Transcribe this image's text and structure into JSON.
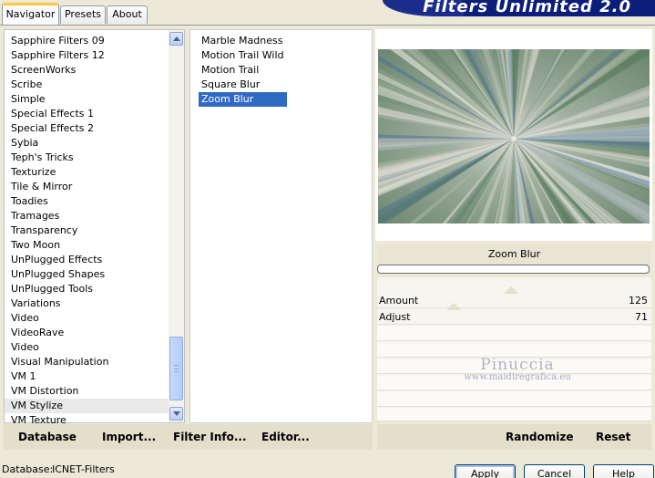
{
  "tabs": [
    {
      "label": "Navigator"
    },
    {
      "label": "Presets"
    },
    {
      "label": "About"
    }
  ],
  "header": {
    "title": "Filters Unlimited 2.0"
  },
  "categories": {
    "items": [
      "Sapphire Filters 09",
      "Sapphire Filters 12",
      "ScreenWorks",
      "Scribe",
      "Simple",
      "Special Effects 1",
      "Special Effects 2",
      "Sybia",
      "Teph's Tricks",
      "Texturize",
      "Tile & Mirror",
      "Toadies",
      "Tramages",
      "Transparency",
      "Two Moon",
      "UnPlugged Effects",
      "UnPlugged Shapes",
      "UnPlugged Tools",
      "Variations",
      "Video",
      "VideoRave",
      "Video",
      "Visual Manipulation",
      "VM 1",
      "VM Distortion",
      "VM Stylize",
      "VM Texture"
    ],
    "selected": "VM Stylize"
  },
  "filters": {
    "items": [
      "Marble Madness",
      "Motion Trail Wild",
      "Motion Trail",
      "Square Blur",
      "Zoom Blur"
    ],
    "selected": "Zoom Blur"
  },
  "preview": {
    "filter_name": "Zoom Blur"
  },
  "parameters": [
    {
      "label": "Amount",
      "value": "125",
      "level": 0.49
    },
    {
      "label": "Adjust",
      "value": "71",
      "level": 0.28
    }
  ],
  "watermark": {
    "name": "Pinuccia",
    "url": "www.maidiregrafica.eu"
  },
  "bottom_left_buttons": {
    "database": "Database",
    "import": "Import...",
    "filter_info": "Filter Info...",
    "editor": "Editor..."
  },
  "bottom_right_buttons": {
    "randomize": "Randomize",
    "reset": "Reset"
  },
  "status": {
    "database_label": "Database:",
    "database_value": "ICNET-Filters",
    "line2_value": "..."
  },
  "dialog_buttons": {
    "apply": "Apply",
    "cancel": "Cancel",
    "help": "Help"
  },
  "colors": {
    "selection": "#316ac5",
    "banner": "#0c1e7a",
    "dialog_bg": "#ece9d8"
  }
}
